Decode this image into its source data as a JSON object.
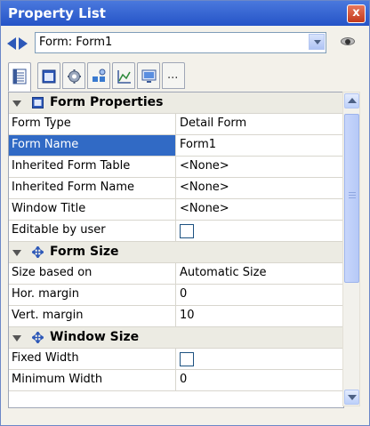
{
  "window": {
    "title": "Property List",
    "close_glyph": "x"
  },
  "object_selector": {
    "value": "Form: Form1"
  },
  "toolbar": {
    "tabs": [
      "properties-tab-icon",
      "form-tab-icon",
      "gear-tab-icon",
      "layout-tab-icon",
      "chart-tab-icon",
      "screen-tab-icon",
      "more-tab-icon"
    ],
    "more_label": "..."
  },
  "sections": {
    "form_properties": "Form Properties",
    "form_size": "Form Size",
    "window_size": "Window Size"
  },
  "properties": {
    "form_type": {
      "label": "Form Type",
      "value": "Detail Form"
    },
    "form_name": {
      "label": "Form Name",
      "value": "Form1"
    },
    "inherited_form_table": {
      "label": "Inherited Form Table",
      "value": "<None>"
    },
    "inherited_form_name": {
      "label": "Inherited Form Name",
      "value": "<None>"
    },
    "window_title": {
      "label": "Window Title",
      "value": "<None>"
    },
    "editable_by_user": {
      "label": "Editable by user",
      "checked": false
    },
    "size_based_on": {
      "label": "Size based on",
      "value": "Automatic Size"
    },
    "hor_margin": {
      "label": "Hor. margin",
      "value": "0"
    },
    "vert_margin": {
      "label": "Vert. margin",
      "value": "10"
    },
    "fixed_width": {
      "label": "Fixed Width",
      "checked": false
    },
    "minimum_width": {
      "label": "Minimum Width",
      "value": "0"
    }
  },
  "colors": {
    "titlebar": "#2554c7",
    "selection": "#316ac5",
    "category_bg": "#ecebe3"
  }
}
